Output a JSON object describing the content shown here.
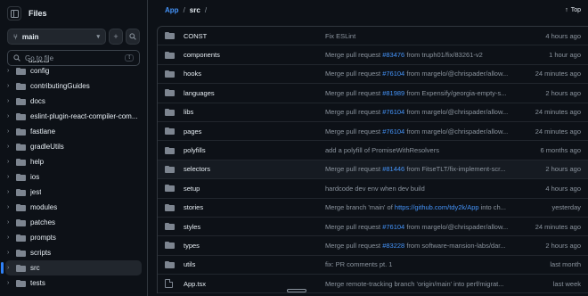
{
  "sidebar": {
    "title": "Files",
    "branch": "main",
    "search_placeholder": "Go to file",
    "search_shortcut": "t",
    "truncated_item": "assets",
    "items": [
      {
        "label": "config"
      },
      {
        "label": "contributingGuides"
      },
      {
        "label": "docs"
      },
      {
        "label": "eslint-plugin-react-compiler-com..."
      },
      {
        "label": "fastlane"
      },
      {
        "label": "gradleUtils"
      },
      {
        "label": "help"
      },
      {
        "label": "ios"
      },
      {
        "label": "jest"
      },
      {
        "label": "modules"
      },
      {
        "label": "patches"
      },
      {
        "label": "prompts"
      },
      {
        "label": "scripts"
      },
      {
        "label": "src",
        "selected": true
      },
      {
        "label": "tests"
      }
    ]
  },
  "breadcrumb": {
    "root": "App",
    "sep1": "/",
    "current": "src",
    "sep2": "/",
    "top_label": "Top"
  },
  "files": [
    {
      "name": "CONST",
      "type": "folder",
      "msg_pre": "Fix ESLint",
      "msg_link": "",
      "msg_post": "",
      "date": "4 hours ago"
    },
    {
      "name": "components",
      "type": "folder",
      "msg_pre": "Merge pull request ",
      "msg_link": "#83476",
      "msg_post": " from truph01/fix/83261-v2",
      "date": "1 hour ago"
    },
    {
      "name": "hooks",
      "type": "folder",
      "msg_pre": "Merge pull request ",
      "msg_link": "#76104",
      "msg_post": " from margelo/@chrispader/allow...",
      "date": "24 minutes ago"
    },
    {
      "name": "languages",
      "type": "folder",
      "msg_pre": "Merge pull request ",
      "msg_link": "#81989",
      "msg_post": " from Expensify/georgia-empty-s...",
      "date": "2 hours ago"
    },
    {
      "name": "libs",
      "type": "folder",
      "msg_pre": "Merge pull request ",
      "msg_link": "#76104",
      "msg_post": " from margelo/@chrispader/allow...",
      "date": "24 minutes ago"
    },
    {
      "name": "pages",
      "type": "folder",
      "msg_pre": "Merge pull request ",
      "msg_link": "#76104",
      "msg_post": " from margelo/@chrispader/allow...",
      "date": "24 minutes ago"
    },
    {
      "name": "polyfills",
      "type": "folder",
      "msg_pre": "add a polyfill of PromiseWithResolvers",
      "msg_link": "",
      "msg_post": "",
      "date": "6 months ago"
    },
    {
      "name": "selectors",
      "type": "folder",
      "msg_pre": "Merge pull request ",
      "msg_link": "#81446",
      "msg_post": " from FitseTLT/fix-implement-scr...",
      "date": "2 hours ago",
      "highlight": true
    },
    {
      "name": "setup",
      "type": "folder",
      "msg_pre": "hardcode dev env when dev build",
      "msg_link": "",
      "msg_post": "",
      "date": "4 hours ago"
    },
    {
      "name": "stories",
      "type": "folder",
      "msg_pre": "Merge branch 'main' of ",
      "msg_link": "https://github.com/tdy2k/App",
      "msg_post": " into ch...",
      "date": "yesterday"
    },
    {
      "name": "styles",
      "type": "folder",
      "msg_pre": "Merge pull request ",
      "msg_link": "#76104",
      "msg_post": " from margelo/@chrispader/allow...",
      "date": "24 minutes ago"
    },
    {
      "name": "types",
      "type": "folder",
      "msg_pre": "Merge pull request ",
      "msg_link": "#83228",
      "msg_post": " from software-mansion-labs/dar...",
      "date": "2 hours ago"
    },
    {
      "name": "utils",
      "type": "folder",
      "msg_pre": "fix: PR comments pt. 1",
      "msg_link": "",
      "msg_post": "",
      "date": "last month"
    },
    {
      "name": "App.tsx",
      "type": "file",
      "msg_pre": "Merge remote-tracking branch 'origin/main' into perf/migrat...",
      "msg_link": "",
      "msg_post": "",
      "date": "last week"
    }
  ]
}
